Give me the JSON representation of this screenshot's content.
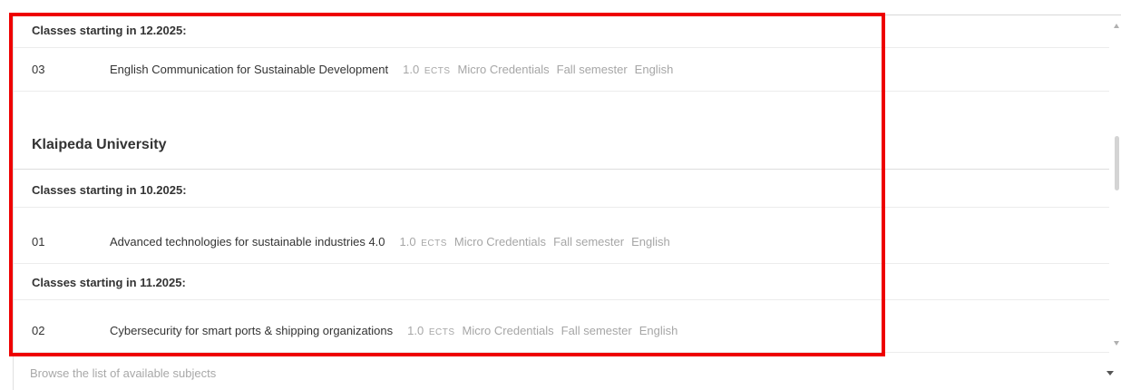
{
  "top_cut_text": "· · · · · · · · · · · · · ·",
  "groups": [
    {
      "type": "class",
      "label": "Classes starting in 12.2025:"
    },
    {
      "type": "course",
      "num": "03",
      "title": "English Communication for Sustainable Development",
      "ects_value": "1.0",
      "ects_unit": "ECTS",
      "type_label": "Micro Credentials",
      "semester": "Fall semester",
      "language": "English"
    }
  ],
  "university": {
    "name": "Klaipeda University",
    "class_groups": [
      {
        "label": "Classes starting in 10.2025:",
        "course": {
          "num": "01",
          "title": "Advanced technologies for sustainable industries 4.0",
          "ects_value": "1.0",
          "ects_unit": "ECTS",
          "type_label": "Micro Credentials",
          "semester": "Fall semester",
          "language": "English"
        }
      },
      {
        "label": "Classes starting in 11.2025:",
        "course": {
          "num": "02",
          "title": "Cybersecurity for smart ports & shipping organizations",
          "ects_value": "1.0",
          "ects_unit": "ECTS",
          "type_label": "Micro Credentials",
          "semester": "Fall semester",
          "language": "English"
        }
      }
    ]
  },
  "browse": {
    "placeholder": "Browse the list of available subjects"
  },
  "colors": {
    "highlight": "#ee0000",
    "muted_text": "#a6a6a6"
  }
}
